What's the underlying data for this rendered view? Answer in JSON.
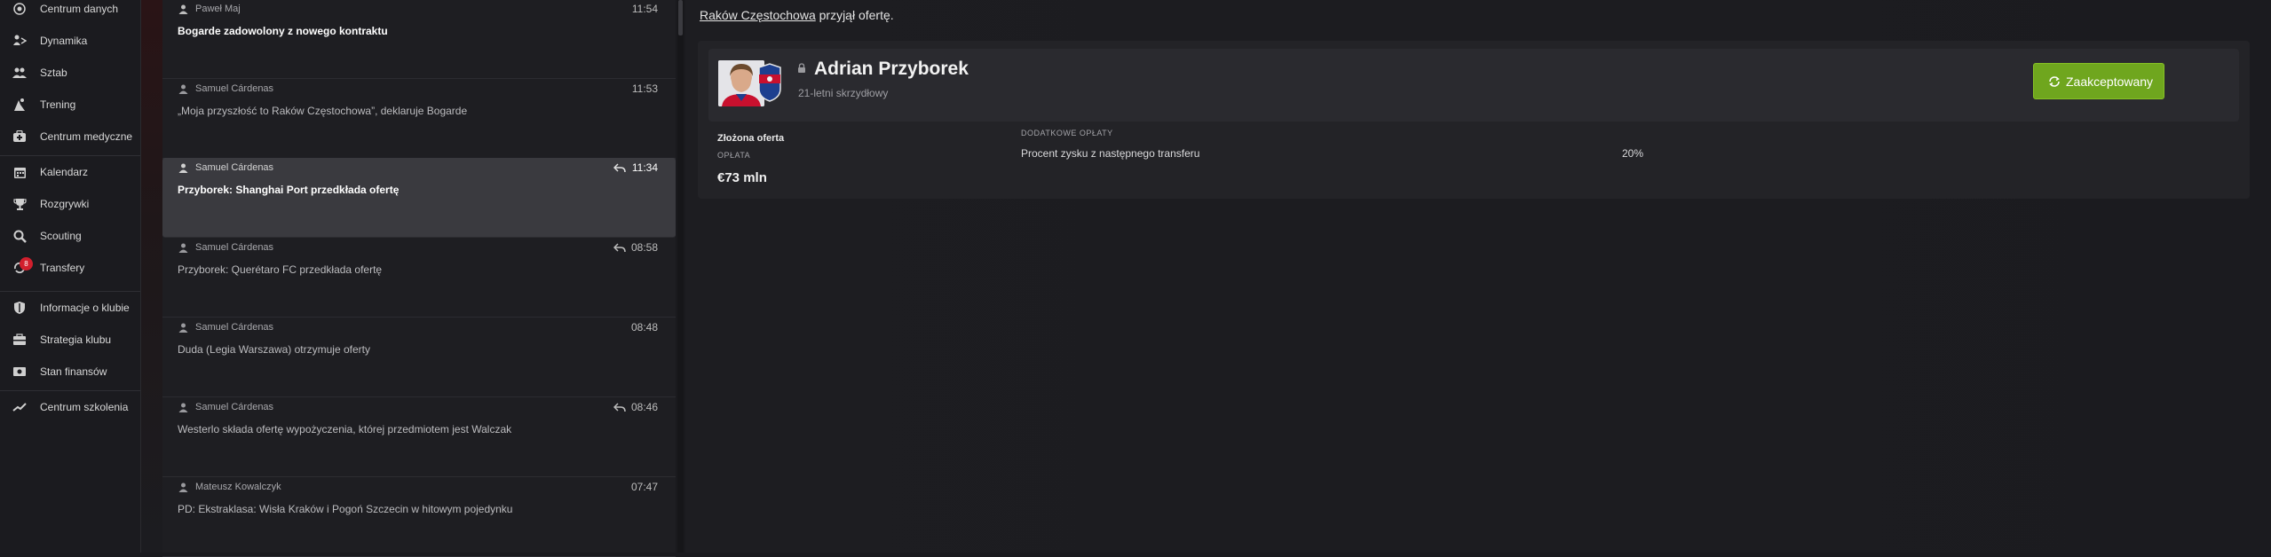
{
  "sidebar": {
    "items": [
      {
        "label": "Centrum danych",
        "icon": "data-center-icon"
      },
      {
        "label": "Dynamika",
        "icon": "dynamics-icon"
      },
      {
        "label": "Sztab",
        "icon": "staff-icon"
      },
      {
        "label": "Trening",
        "icon": "training-icon"
      },
      {
        "label": "Centrum medyczne",
        "icon": "medical-icon"
      },
      {
        "label": "Kalendarz",
        "icon": "calendar-icon"
      },
      {
        "label": "Rozgrywki",
        "icon": "trophy-icon"
      },
      {
        "label": "Scouting",
        "icon": "search-icon"
      },
      {
        "label": "Transfery",
        "icon": "transfers-icon",
        "badge": "8"
      },
      {
        "label": "Informacje o klubie",
        "icon": "shield-icon"
      },
      {
        "label": "Strategia klubu",
        "icon": "strategy-icon"
      },
      {
        "label": "Stan finansów",
        "icon": "finances-icon"
      },
      {
        "label": "Centrum szkolenia",
        "icon": "training-center-icon"
      }
    ]
  },
  "messages": [
    {
      "sender": "Paweł Maj",
      "time": "11:54",
      "subject": "Bogarde zadowolony z nowego kontraktu",
      "unread": true,
      "replied": false
    },
    {
      "sender": "Samuel Cárdenas",
      "time": "11:53",
      "subject": "„Moja przyszłość to Raków Częstochowa”, deklaruje Bogarde",
      "unread": false,
      "replied": false
    },
    {
      "sender": "Samuel Cárdenas",
      "time": "11:34",
      "subject": "Przyborek: Shanghai Port przedkłada ofertę",
      "unread": true,
      "replied": true,
      "selected": true
    },
    {
      "sender": "Samuel Cárdenas",
      "time": "08:58",
      "subject": "Przyborek: Querétaro FC przedkłada ofertę",
      "unread": false,
      "replied": true
    },
    {
      "sender": "Samuel Cárdenas",
      "time": "08:48",
      "subject": "Duda (Legia Warszawa) otrzymuje oferty",
      "unread": false,
      "replied": false
    },
    {
      "sender": "Samuel Cárdenas",
      "time": "08:46",
      "subject": "Westerlo składa ofertę wypożyczenia, której przedmiotem jest Walczak",
      "unread": false,
      "replied": true
    },
    {
      "sender": "Mateusz Kowalczyk",
      "time": "07:47",
      "subject": "PD: Ekstraklasa: Wisła Kraków i Pogoń Szczecin w hitowym pojedynku",
      "unread": false,
      "replied": false
    }
  ],
  "detail": {
    "headline_club": "Raków Częstochowa",
    "headline_rest": " przyjął ofertę.",
    "player_name": "Adrian Przyborek",
    "player_desc": "21-letni skrzydłowy",
    "accept_label": "Zaakceptowany",
    "offer_title": "Złożona oferta",
    "fee_label": "OPŁATA",
    "fee_value": "€73 mln",
    "extra_label": "DODATKOWE OPŁATY",
    "extra_item": "Procent zysku z następnego transferu",
    "extra_value": "20%"
  },
  "colors": {
    "accent_green": "#6fa61e",
    "badge_red": "#d21f2d",
    "club_red": "#c8102e",
    "club_blue": "#1d3f8f"
  }
}
